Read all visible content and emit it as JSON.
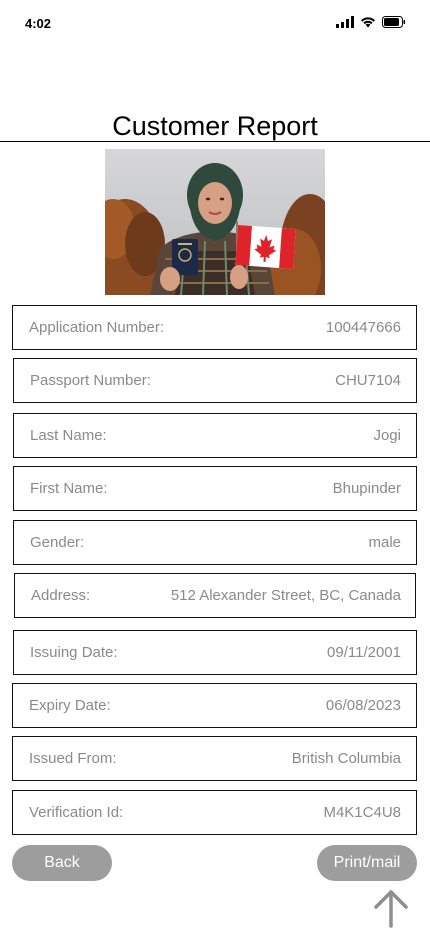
{
  "status_bar": {
    "time": "4:02",
    "icons": [
      "signal-icon",
      "wifi-icon",
      "battery-icon"
    ]
  },
  "header": {
    "title": "Customer Report"
  },
  "photo": {
    "description_icon": "traveler-photo"
  },
  "fields": [
    {
      "label": "Application Number:",
      "value": "100447666"
    },
    {
      "label": "Passport Number:",
      "value": "CHU7104"
    },
    {
      "label": "Last Name:",
      "value": "Jogi"
    },
    {
      "label": "First Name:",
      "value": "Bhupinder"
    },
    {
      "label": "Gender:",
      "value": "male"
    },
    {
      "label": "Address:",
      "value": "512 Alexander Street, BC, Canada"
    },
    {
      "label": "Issuing Date:",
      "value": "09/11/2001"
    },
    {
      "label": "Expiry Date:",
      "value": "06/08/2023"
    },
    {
      "label": "Issued From:",
      "value": "British Columbia"
    },
    {
      "label": "Verification Id:",
      "value": "M4K1C4U8"
    }
  ],
  "actions": {
    "back_label": "Back",
    "print_label": "Print/mail",
    "scroll_top_icon": "arrow-up-icon"
  },
  "colors": {
    "field_text": "#8a8a8a",
    "button_bg": "#9d9d9d",
    "button_text": "#ffffff"
  }
}
